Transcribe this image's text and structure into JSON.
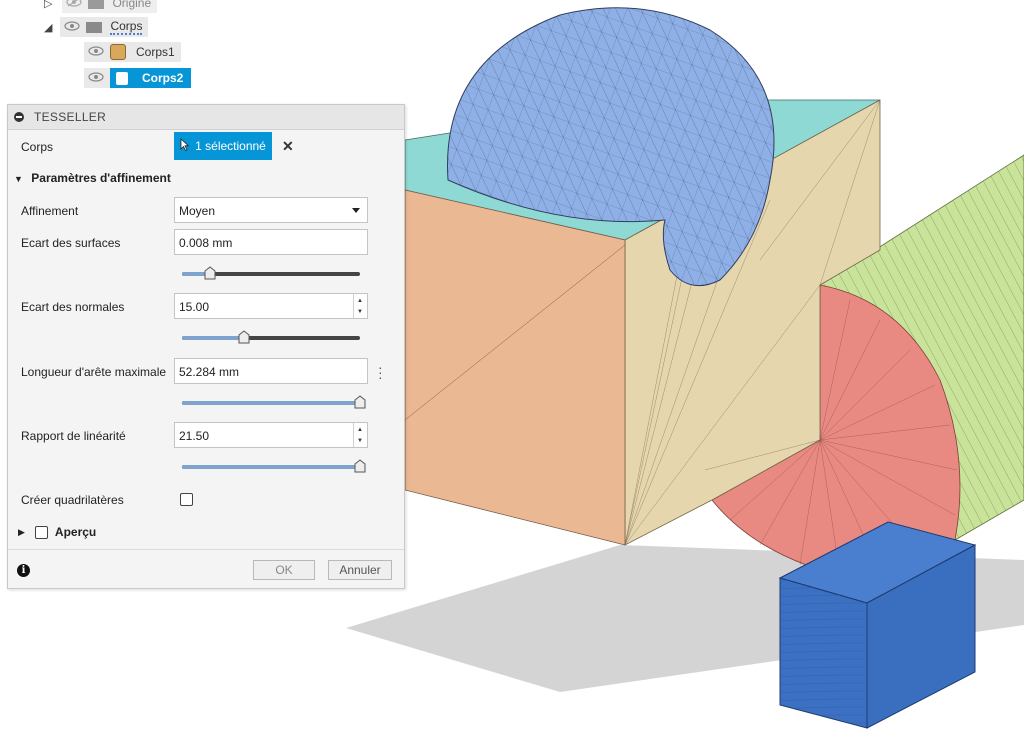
{
  "browser": {
    "items": [
      {
        "label": "Origine"
      },
      {
        "label": "Corps"
      },
      {
        "label": "Corps1"
      },
      {
        "label": "Corps2"
      }
    ]
  },
  "dialog": {
    "title": "TESSELLER",
    "corps_label": "Corps",
    "selection_button": "1 sélectionné",
    "section_title": "Paramètres d'affinement",
    "refinement": {
      "label": "Affinement",
      "value": "Moyen"
    },
    "surface_deviation": {
      "label": "Ecart des surfaces",
      "value": "0.008 mm",
      "slider": 0.16
    },
    "normal_deviation": {
      "label": "Ecart des normales",
      "value": "15.00",
      "slider": 0.35
    },
    "max_edge_length": {
      "label": "Longueur d'arête maximale",
      "value": "52.284 mm",
      "slider": 1.0
    },
    "aspect_ratio": {
      "label": "Rapport de linéarité",
      "value": "21.50",
      "slider": 1.0
    },
    "quads": {
      "label": "Créer quadrilatères",
      "checked": false
    },
    "preview": {
      "label": "Aperçu",
      "checked": false
    },
    "ok_label": "OK",
    "cancel_label": "Annuler"
  },
  "icons": {
    "collapse": "collapse-icon",
    "eye": "eye-icon",
    "folder": "folder-icon",
    "body": "body-icon",
    "cursor": "cursor-icon",
    "close": "close-icon",
    "info": "info-icon",
    "dropdown": "chevron-down-icon",
    "more": "more-icon"
  },
  "colors": {
    "accent": "#0696d7",
    "slider_fill": "#7fa3cf",
    "sphere": "#8fb0e6",
    "box_front": "#ebb894",
    "box_side": "#e6d6ad",
    "box_top": "#8fd9d4",
    "cylinder": "#c9e49a",
    "cylinder_cap": "#e98a82",
    "small_box": "#3a6fbf"
  }
}
